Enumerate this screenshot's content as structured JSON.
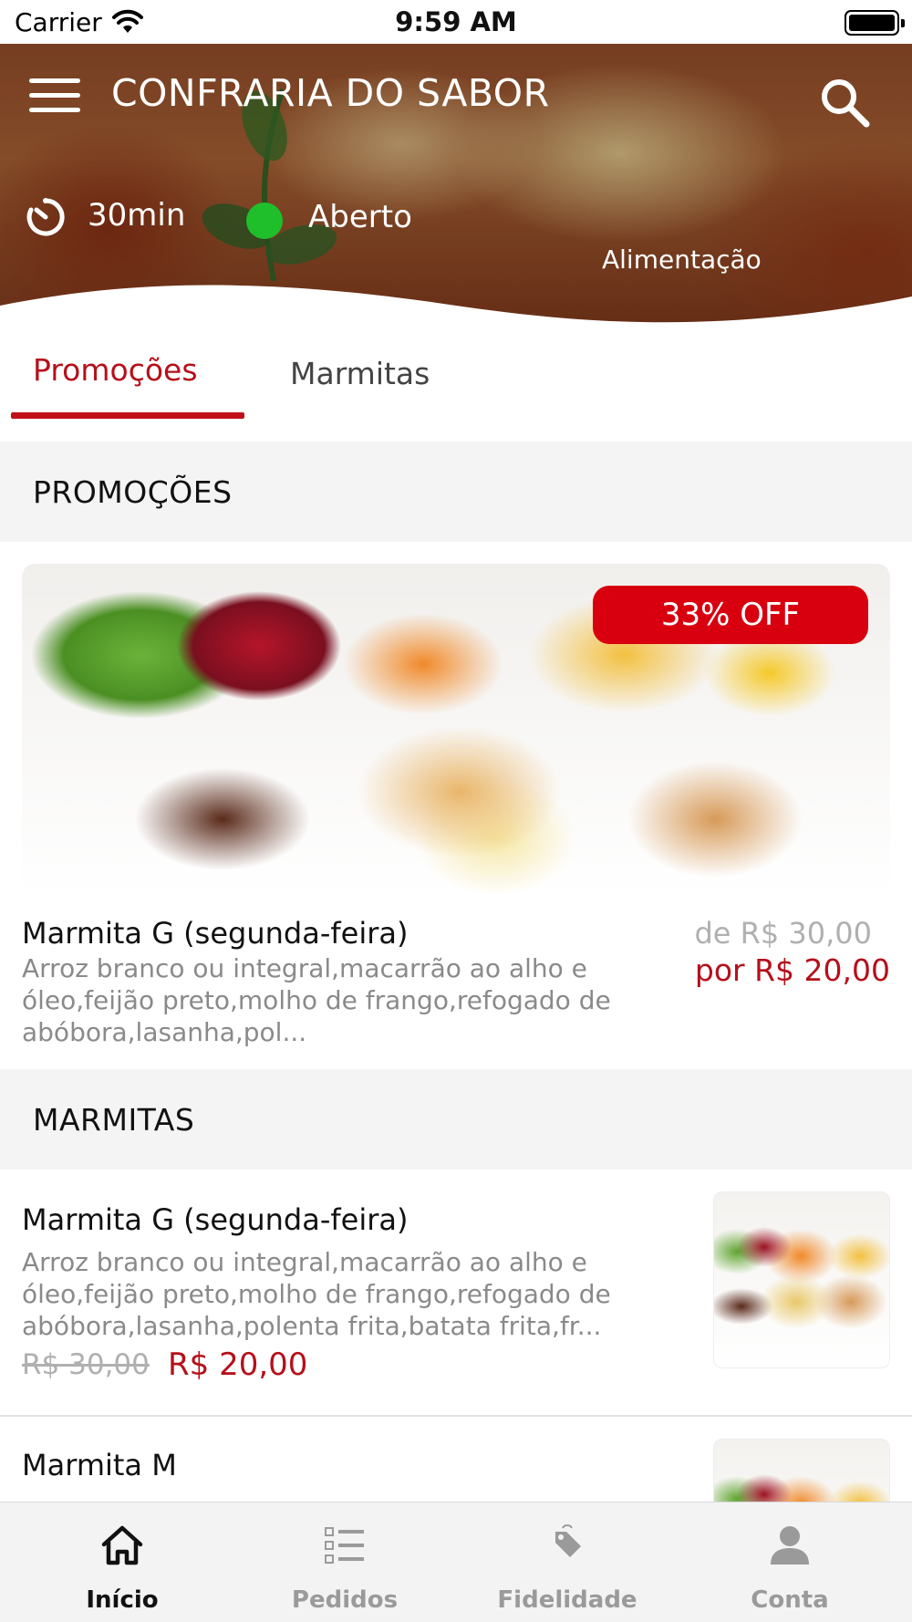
{
  "status_bar": {
    "carrier": "Carrier",
    "time": "9:59 AM"
  },
  "header": {
    "title": "CONFRARIA DO SABOR",
    "delivery_time": "30min",
    "status": "Aberto",
    "status_color": "#1fbf2b",
    "category": "Alimentação"
  },
  "tabs": [
    {
      "label": "Promoções",
      "active": true
    },
    {
      "label": "Marmitas",
      "active": false
    }
  ],
  "sections": {
    "promocoes": "PROMOÇÕES",
    "marmitas": "MARMITAS"
  },
  "promo_card": {
    "badge": "33% OFF",
    "title": "Marmita G (segunda-feira)",
    "description": "Arroz branco ou integral,macarrão ao alho e óleo,feijão preto,molho de frango,refogado de abóbora,lasanha,pol...",
    "old_price": "de R$ 30,00",
    "new_price": "por R$ 20,00"
  },
  "products": [
    {
      "title": "Marmita G (segunda-feira)",
      "description": "Arroz branco ou integral,macarrão ao alho e óleo,feijão preto,molho de frango,refogado de abóbora,lasanha,polenta frita,batata frita,fr...",
      "old_price": "R$ 30,00",
      "new_price": "R$ 20,00"
    },
    {
      "title": "Marmita M"
    }
  ],
  "bottom_nav": [
    {
      "label": "Início",
      "icon": "home-icon",
      "active": true
    },
    {
      "label": "Pedidos",
      "icon": "checklist-icon",
      "active": false
    },
    {
      "label": "Fidelidade",
      "icon": "tag-icon",
      "active": false
    },
    {
      "label": "Conta",
      "icon": "person-icon",
      "active": false
    }
  ],
  "colors": {
    "accent": "#b5101b",
    "badge": "#d8000f",
    "open_indicator": "#1fbf2b"
  }
}
